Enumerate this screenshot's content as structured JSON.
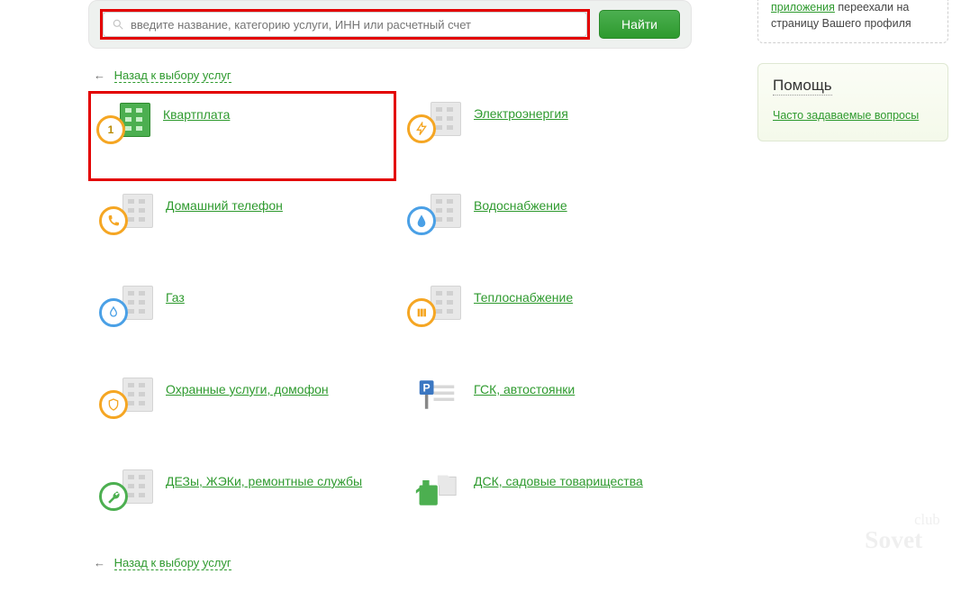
{
  "search": {
    "placeholder": "введите название, категорию услуги, ИНН или расчетный счет",
    "button": "Найти"
  },
  "back_link": "Назад к выбору услуг",
  "categories": [
    {
      "label": "Квартплата"
    },
    {
      "label": "Электроэнергия"
    },
    {
      "label": "Домашний телефон"
    },
    {
      "label": "Водоснабжение"
    },
    {
      "label": "Газ"
    },
    {
      "label": "Теплоснабжение"
    },
    {
      "label": "Охранные услуги, домофон"
    },
    {
      "label": "ГСК, автостоянки"
    },
    {
      "label": "ДЕЗы, ЖЭКи, ремонтные службы"
    },
    {
      "label": "ДСК, садовые товарищества"
    }
  ],
  "sidebar": {
    "notice_link": "приложения",
    "notice_rest": " переехали на страницу Вашего профиля",
    "help_title": "Помощь",
    "faq": "Часто задаваемые вопросы"
  },
  "watermark": "club Sovet"
}
